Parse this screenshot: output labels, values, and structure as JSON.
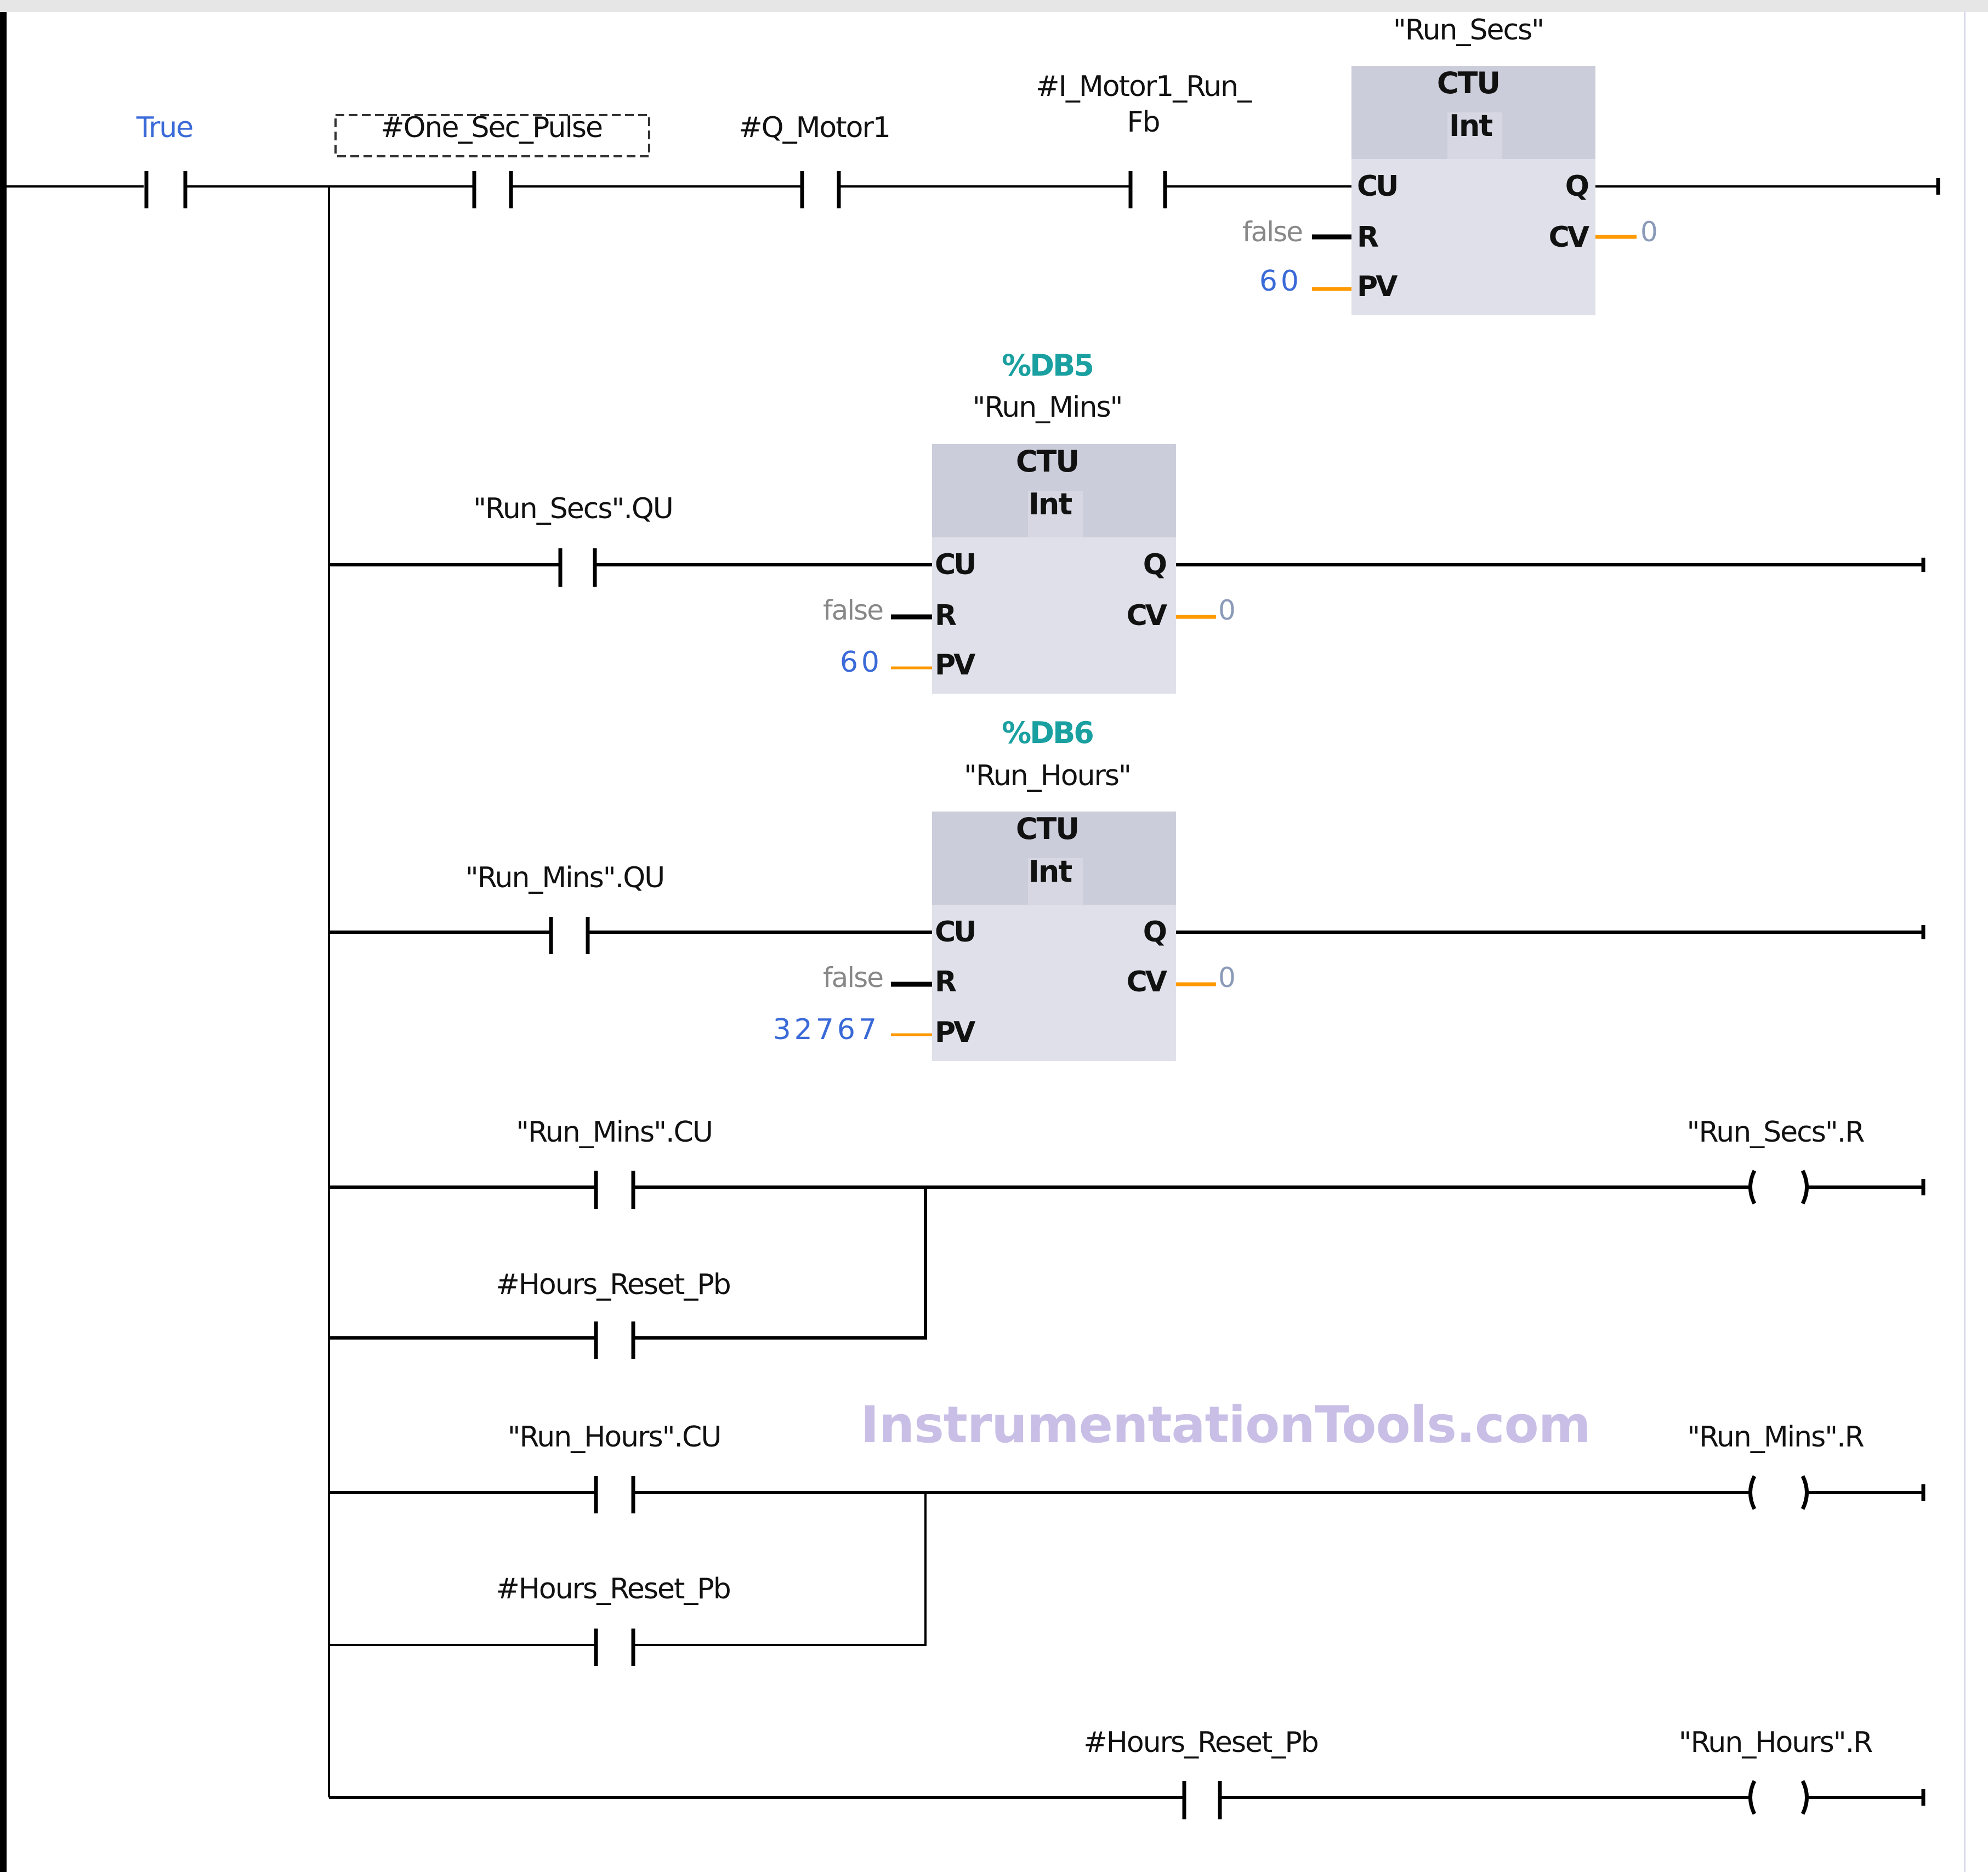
{
  "editor": {
    "language": "LAD",
    "watermark": "InstrumentationTools.com"
  },
  "colors": {
    "block_header": "#cbcdda",
    "block_body": "#dfe0e9",
    "db_label": "#1aa0a0",
    "constant_blue": "#3a6ad8",
    "constant_gray": "#888888",
    "int_wire": "#ff9900",
    "watermark": "#c9bfe6"
  },
  "rungs": {
    "r1": {
      "contact_true": "True",
      "contact_pulse": "#One_Sec_Pulse",
      "contact_qmotor": "#Q_Motor1",
      "contact_fb_line1": "#I_Motor1_Run_",
      "contact_fb_line2": "Fb",
      "block": {
        "db": "",
        "instance": "\"Run_Secs\"",
        "type": "CTU",
        "datatype": "Int",
        "pin_cu": "CU",
        "pin_r": "R",
        "pin_pv": "PV",
        "pin_q": "Q",
        "pin_cv": "CV",
        "r_value": "false",
        "pv_value": "60",
        "cv_value": "0"
      }
    },
    "r2": {
      "contact": "\"Run_Secs\".QU",
      "block": {
        "db": "%DB5",
        "instance": "\"Run_Mins\"",
        "type": "CTU",
        "datatype": "Int",
        "pin_cu": "CU",
        "pin_r": "R",
        "pin_pv": "PV",
        "pin_q": "Q",
        "pin_cv": "CV",
        "r_value": "false",
        "pv_value": "60",
        "cv_value": "0"
      }
    },
    "r3": {
      "contact": "\"Run_Mins\".QU",
      "block": {
        "db": "%DB6",
        "instance": "\"Run_Hours\"",
        "type": "CTU",
        "datatype": "Int",
        "pin_cu": "CU",
        "pin_r": "R",
        "pin_pv": "PV",
        "pin_q": "Q",
        "pin_cv": "CV",
        "r_value": "false",
        "pv_value": "32767",
        "cv_value": "0"
      }
    },
    "r4": {
      "contact_a": "\"Run_Mins\".CU",
      "contact_b": "#Hours_Reset_Pb",
      "coil": "\"Run_Secs\".R"
    },
    "r5": {
      "contact_a": "\"Run_Hours\".CU",
      "contact_b": "#Hours_Reset_Pb",
      "coil": "\"Run_Mins\".R"
    },
    "r6": {
      "contact": "#Hours_Reset_Pb",
      "coil": "\"Run_Hours\".R"
    }
  }
}
